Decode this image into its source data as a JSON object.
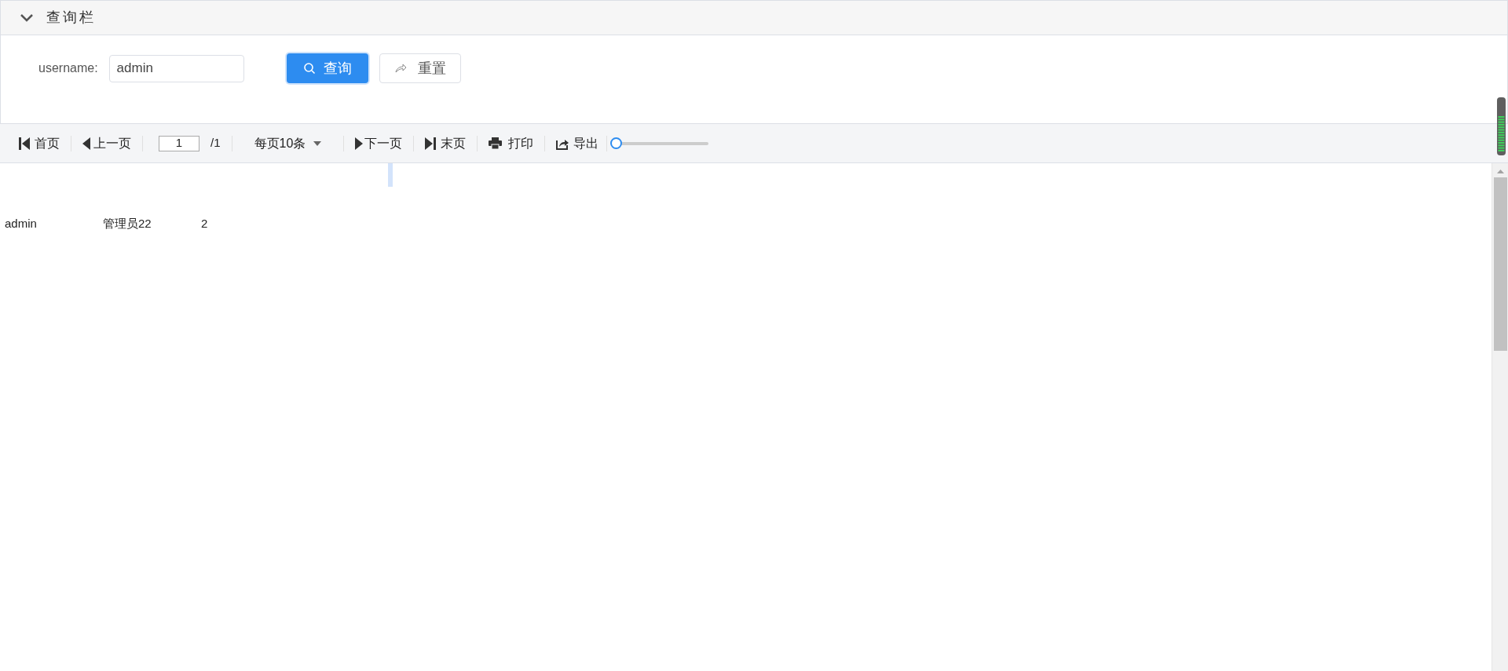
{
  "query_panel": {
    "title": "查询栏",
    "expanded": true,
    "fields": [
      {
        "label": "username:",
        "value": "admin"
      }
    ],
    "buttons": [
      {
        "kind": "primary",
        "label": "查询"
      },
      {
        "kind": "default",
        "label": "重置"
      }
    ]
  },
  "toolbar": {
    "first": "首页",
    "prev": "上一页",
    "page": "1",
    "total": "/1",
    "page_size": "每页10条",
    "next": "下一页",
    "last": "末页",
    "print": "打印",
    "export": "导出",
    "zoom": {
      "level": 0
    }
  },
  "table": {
    "rows": [
      [
        "admin",
        "管理员22",
        "2"
      ]
    ]
  }
}
